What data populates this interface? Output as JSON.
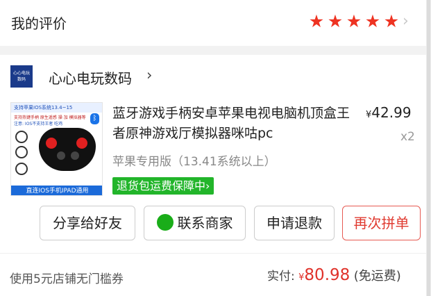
{
  "rating": {
    "title": "我的评价",
    "stars": [
      "★",
      "★",
      "★",
      "★",
      "★"
    ],
    "chevron": "›"
  },
  "store": {
    "logo_text": "心心电玩\n数码",
    "name": "心心电玩数码",
    "chevron": "›"
  },
  "product": {
    "image_text": {
      "top": "支持苹果IOS系统13.4~15",
      "line1": "支持热键手柄 原生遥感 操 加 模拟器等",
      "line2": "注意: IOS不支持王者 吃鸡",
      "bottom": "直连IOS手机IPAD通用"
    },
    "title": "蓝牙游戏手柄安卓苹果电视电脑机顶盒王者原神游戏厅模拟器咪咕pc",
    "price_currency": "¥",
    "price": "42.99",
    "quantity": "x2",
    "spec": "苹果专用版（13.41系统以上）",
    "return_badge": "退货包运费保障中›"
  },
  "actions": {
    "share": "分享给好友",
    "contact": "联系商家",
    "refund": "申请退款",
    "buy_again": "再次拼单"
  },
  "footer": {
    "coupon": "使用5元店铺无门槛券",
    "paid_label": "实付:",
    "paid_currency": "¥",
    "paid_amount": "80.98",
    "paid_note": "(免运费)"
  },
  "colors": {
    "star": "#ee3322",
    "price_red": "#e0322a",
    "badge_green": "#22b52a",
    "wechat_green": "#1aad19"
  }
}
